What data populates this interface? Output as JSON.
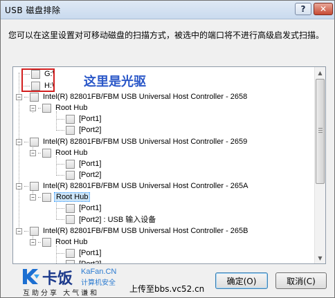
{
  "window": {
    "title": "USB 磁盘排除",
    "help_label": "?",
    "close_label": "✕"
  },
  "instruction": "您可以在这里设置对可移动磁盘的扫描方式，被选中的端口将不进行高级启发式扫描。",
  "annotation": "这里是光驱",
  "tree": {
    "drive_g": "G:\\",
    "drive_h": "H:\\",
    "controller_2658": "Intel(R) 82801FB/FBM USB Universal Host Controller - 2658",
    "controller_2659": "Intel(R) 82801FB/FBM USB Universal Host Controller - 2659",
    "controller_265a": "Intel(R) 82801FB/FBM USB Universal Host Controller - 265A",
    "controller_265b": "Intel(R) 82801FB/FBM USB Universal Host Controller - 265B",
    "root_hub": "Root Hub",
    "port1": "[Port1]",
    "port2": "[Port2]",
    "port2_device": "[Port2] : USB 输入设备",
    "expander_minus": "−"
  },
  "footer": {
    "logo_cn": "卡饭",
    "logo_en": "KaFan.CN",
    "logo_sub": "计算机安全",
    "logo_slogan": "互助分享  大气谦和",
    "upload_text": "上传至bbs.vc52.cn",
    "ok_label": "确定(O)",
    "cancel_label": "取消(C)"
  },
  "colors": {
    "annotation": "#2a57c8",
    "highlight": "#d21d1d",
    "selection": "#cce4f7"
  }
}
